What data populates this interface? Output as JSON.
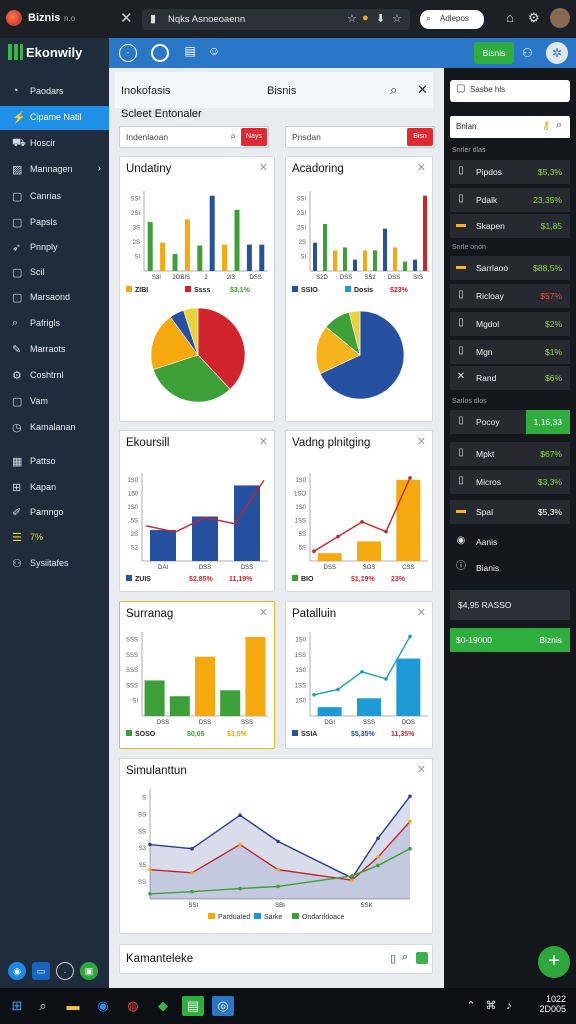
{
  "app": {
    "name": "Biznis",
    "version": "n.o",
    "url": "Nqks Asnoeoaenn"
  },
  "titlebar": {
    "search_label": "Adlepos"
  },
  "sidebar": {
    "brand": "Ekonwily",
    "items": [
      {
        "label": "Paodars",
        "icon": "speedometer-icon"
      },
      {
        "label": "Cipame Natil",
        "icon": "bolt-icon"
      },
      {
        "label": "Hoscir",
        "icon": "car-icon"
      },
      {
        "label": "Mannagen",
        "icon": "chart-icon"
      },
      {
        "label": "Canrias",
        "icon": "square-icon"
      },
      {
        "label": "Papsls",
        "icon": "square-icon"
      },
      {
        "label": "Pnnply",
        "icon": "rocket-icon"
      },
      {
        "label": "Scil",
        "icon": "square-icon"
      },
      {
        "label": "Marsaond",
        "icon": "square-icon"
      },
      {
        "label": "Pafrigls",
        "icon": "search-icon"
      },
      {
        "label": "Marraots",
        "icon": "wrench-icon"
      },
      {
        "label": "Coshtrnl",
        "icon": "gear-icon"
      },
      {
        "label": "Vam",
        "icon": "square-icon"
      },
      {
        "label": "Kamalanan",
        "icon": "clock-icon"
      },
      {
        "label": "Pattso",
        "icon": "calendar-icon"
      },
      {
        "label": "Kapan",
        "icon": "grid-icon"
      },
      {
        "label": "Pamngo",
        "icon": "pen-icon"
      },
      {
        "label": "7%",
        "icon": "list-icon"
      },
      {
        "label": "Sysiitafes",
        "icon": "users-icon"
      }
    ]
  },
  "topbar": {
    "button_label": "Bisnis"
  },
  "panel": {
    "title_left": "Inokofasis",
    "title_center": "Bisnis",
    "select_heading": "Scleet Entonaler",
    "filter1": {
      "value": "Indenlaoan",
      "button": "Nays"
    },
    "filter2": {
      "value": "Pnsdan",
      "button": "Bisn"
    }
  },
  "cards": [
    {
      "title": "Undatiny",
      "legend1": "ZIBI",
      "legend2": "Ssss",
      "value": "$3,1%"
    },
    {
      "title": "Acadoring",
      "legend1": "SSIO",
      "legend2": "Dosis",
      "value": "$23%"
    },
    {
      "title": "Ekoursill",
      "legend1": "ZUIS",
      "legend2": "$2,85%",
      "value": "11,19%"
    },
    {
      "title": "Vadng plnitging",
      "legend1": "BIO",
      "legend2": "$1,19%",
      "value": "23%"
    },
    {
      "title": "Surranag",
      "legend1": "SOSO",
      "legend2": "$0,05",
      "value": "$3,5%"
    },
    {
      "title": "Patalluin",
      "legend1": "SSIA",
      "legend2": "$5,35%",
      "value": "11,35%"
    },
    {
      "title": "Simulanttun",
      "legend1": "Parduated",
      "legend2": "Sarke",
      "legend3": "Ondarrldoace"
    },
    {
      "title": "Kamanteleke"
    }
  ],
  "chart_data": [
    {
      "type": "bar",
      "title": "Undatiny",
      "x_tick_labels": [
        "S3I",
        "2OBIS",
        "2",
        "2I3",
        "DSS"
      ],
      "y_tick_labels": [
        "SSI",
        "2SI",
        "3S",
        "2S",
        "SI"
      ],
      "series": [
        {
          "values": [
            52,
            30,
            18,
            55,
            27,
            80,
            28,
            65,
            28,
            28
          ]
        }
      ]
    },
    {
      "type": "pie",
      "title": "Undatiny",
      "values": [
        38,
        32,
        20,
        5,
        5
      ],
      "colors": [
        "#d0232b",
        "#3c9f37",
        "#f5a90f",
        "#2650a0",
        "#e8d33a"
      ]
    },
    {
      "type": "bar",
      "title": "Acadoring",
      "x_tick_labels": [
        "S2D",
        "DSS",
        "SS2",
        "DSS",
        "SIS"
      ],
      "y_tick_labels": [
        "SSI",
        "2SI",
        "2SI",
        "2S",
        "SI"
      ],
      "series": [
        {
          "values": [
            30,
            50,
            22,
            25,
            12,
            22,
            22,
            45,
            25,
            10,
            12,
            80
          ]
        }
      ]
    },
    {
      "type": "pie",
      "title": "Acadoring",
      "values": [
        68,
        18,
        10,
        4
      ],
      "colors": [
        "#2650a0",
        "#f5b31e",
        "#3c9f37",
        "#e8d33a"
      ]
    },
    {
      "type": "bar",
      "title": "Ekoursill",
      "x_tick_labels": [
        "DAI",
        "DSS",
        "DSS"
      ],
      "y_tick_labels": [
        "1S0",
        "150",
        "1S0",
        "5S",
        "2S",
        "S2"
      ],
      "series": [
        {
          "name": "bars",
          "values": [
            30,
            43,
            73
          ]
        },
        {
          "name": "line",
          "values": [
            34,
            28,
            42,
            36,
            78
          ]
        }
      ]
    },
    {
      "type": "bar",
      "title": "Vadng plnitging",
      "x_tick_labels": [
        "DSS",
        "SOS",
        "CSS"
      ],
      "y_tick_labels": [
        "1S0",
        "1SO",
        "1S0",
        "1SS",
        "5S",
        "5S"
      ],
      "series": [
        {
          "name": "bars",
          "values": [
            8,
            20,
            83
          ]
        },
        {
          "name": "line",
          "values": [
            10,
            25,
            40,
            30,
            85
          ]
        }
      ]
    },
    {
      "type": "bar",
      "title": "Surranag",
      "x_tick_labels": [
        "DSS",
        "DSS",
        "SSS"
      ],
      "y_tick_labels": [
        "SSS",
        "SSS",
        "SSS",
        "SSS",
        "SI"
      ],
      "series": [
        {
          "values": [
            36,
            20,
            60,
            26,
            80
          ]
        }
      ]
    },
    {
      "type": "bar",
      "title": "Patalluin",
      "x_tick_labels": [
        "DGI",
        "SSS",
        "DOS"
      ],
      "y_tick_labels": [
        "1S0",
        "1SS",
        "1S0",
        "1SS",
        "1S0"
      ],
      "series": [
        {
          "name": "bars",
          "values": [
            10,
            20,
            65
          ]
        },
        {
          "name": "line",
          "values": [
            24,
            30,
            50,
            42,
            90
          ]
        }
      ]
    },
    {
      "type": "area",
      "title": "Simulanttun",
      "x_tick_labels": [
        "SSI",
        "SBI",
        "SSK"
      ],
      "y_tick_labels": [
        "S",
        "SS",
        "SS",
        "S3",
        "S5",
        "SS"
      ],
      "series": [
        {
          "name": "Parduated",
          "values": [
            52,
            48,
            80,
            55,
            20,
            58,
            98
          ]
        },
        {
          "name": "Sarke",
          "values": [
            28,
            25,
            52,
            28,
            18,
            40,
            74
          ]
        },
        {
          "name": "Ondarrldoace",
          "values": [
            5,
            7,
            10,
            12,
            22,
            32,
            48
          ]
        }
      ]
    }
  ],
  "sidepanel": {
    "search_placeholder": "Sasbe hls",
    "field_value": "Bnlan",
    "section1": "Snrler dlas",
    "section2": "Snrle onon",
    "section3": "Sarlos dlos",
    "rows": [
      {
        "label": "Pipdos",
        "value": "$5,3%",
        "icon": "list-icon"
      },
      {
        "label": "Pdalk",
        "value": "23,35%",
        "icon": "list-icon"
      },
      {
        "label": "Skapen",
        "value": "$1,85",
        "icon": "folder-icon"
      },
      {
        "label": "Sarrlaoo",
        "value": "$88,5%",
        "icon": "folder-icon"
      },
      {
        "label": "Ricloay",
        "value": "$57%",
        "icon": "list-icon"
      },
      {
        "label": "Mgdol",
        "value": "$2%",
        "icon": "list-icon"
      },
      {
        "label": "Mgn",
        "value": "$1%",
        "icon": "list-icon"
      },
      {
        "label": "Rand",
        "value": "$6%",
        "icon": "star-icon"
      },
      {
        "label": "Pocoy",
        "value": "1,16,33",
        "icon": "list-icon"
      },
      {
        "label": "Mpkt",
        "value": "$67%",
        "icon": "list-icon"
      },
      {
        "label": "Micros",
        "value": "$3,3%",
        "icon": "list-icon"
      },
      {
        "label": "Spal",
        "value": "$5,3%",
        "icon": "folder-icon"
      },
      {
        "label": "Aanis",
        "icon": "pin-icon"
      },
      {
        "label": "Bianis",
        "icon": "info-icon"
      }
    ],
    "total_label": "$4,95 RASSO",
    "green_bar_label": "$0-19000",
    "green_bar_action": "Biznis"
  },
  "taskbar": {
    "time": "1022",
    "date": "2D005"
  }
}
